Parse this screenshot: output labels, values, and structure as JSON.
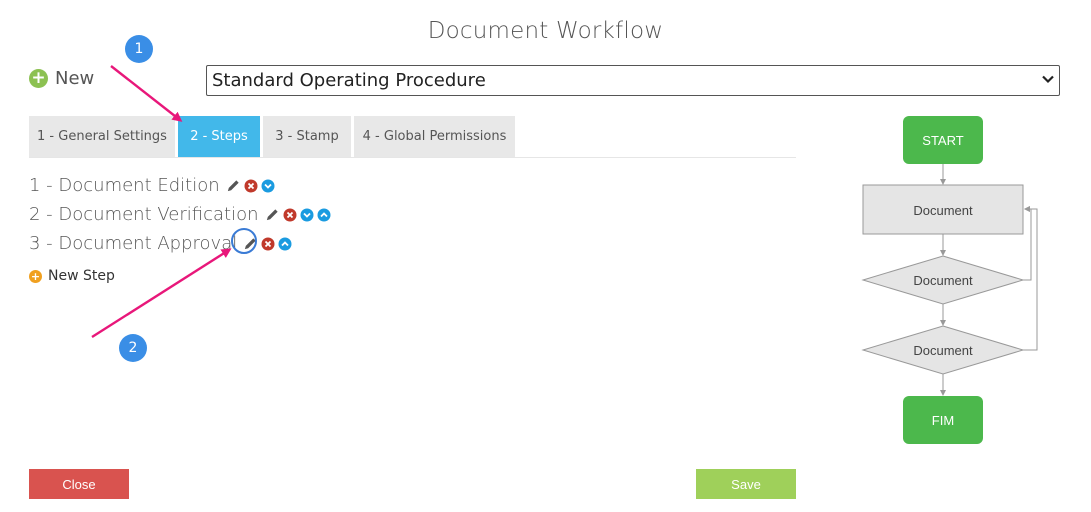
{
  "dialog": {
    "title": "Document Workflow"
  },
  "toolbar": {
    "new_label": "New"
  },
  "workflow_select": {
    "selected": "Standard Operating Procedure"
  },
  "tabs": [
    {
      "label": "1 - General Settings",
      "active": false
    },
    {
      "label": "2 - Steps",
      "active": true
    },
    {
      "label": "3 - Stamp",
      "active": false
    },
    {
      "label": "4 - Global Permissions",
      "active": false
    }
  ],
  "steps": [
    {
      "label": "1 - Document Edition"
    },
    {
      "label": "2 - Document Verification"
    },
    {
      "label": "3 - Document Approval"
    }
  ],
  "new_step_label": "New Step",
  "footer": {
    "close_label": "Close",
    "save_label": "Save"
  },
  "annotations": {
    "badge_1": "1",
    "badge_2": "2"
  },
  "flowchart": {
    "start_label": "START",
    "node_1": "Document",
    "node_2": "Document",
    "node_3": "Document",
    "end_label": "FIM"
  },
  "colors": {
    "accent": "#42b8ea",
    "close": "#d9534f",
    "save": "#9fd05a",
    "flow_terminal": "#4cb84c",
    "annotation_arrow": "#e8177a",
    "badge": "#3a8ee6"
  }
}
